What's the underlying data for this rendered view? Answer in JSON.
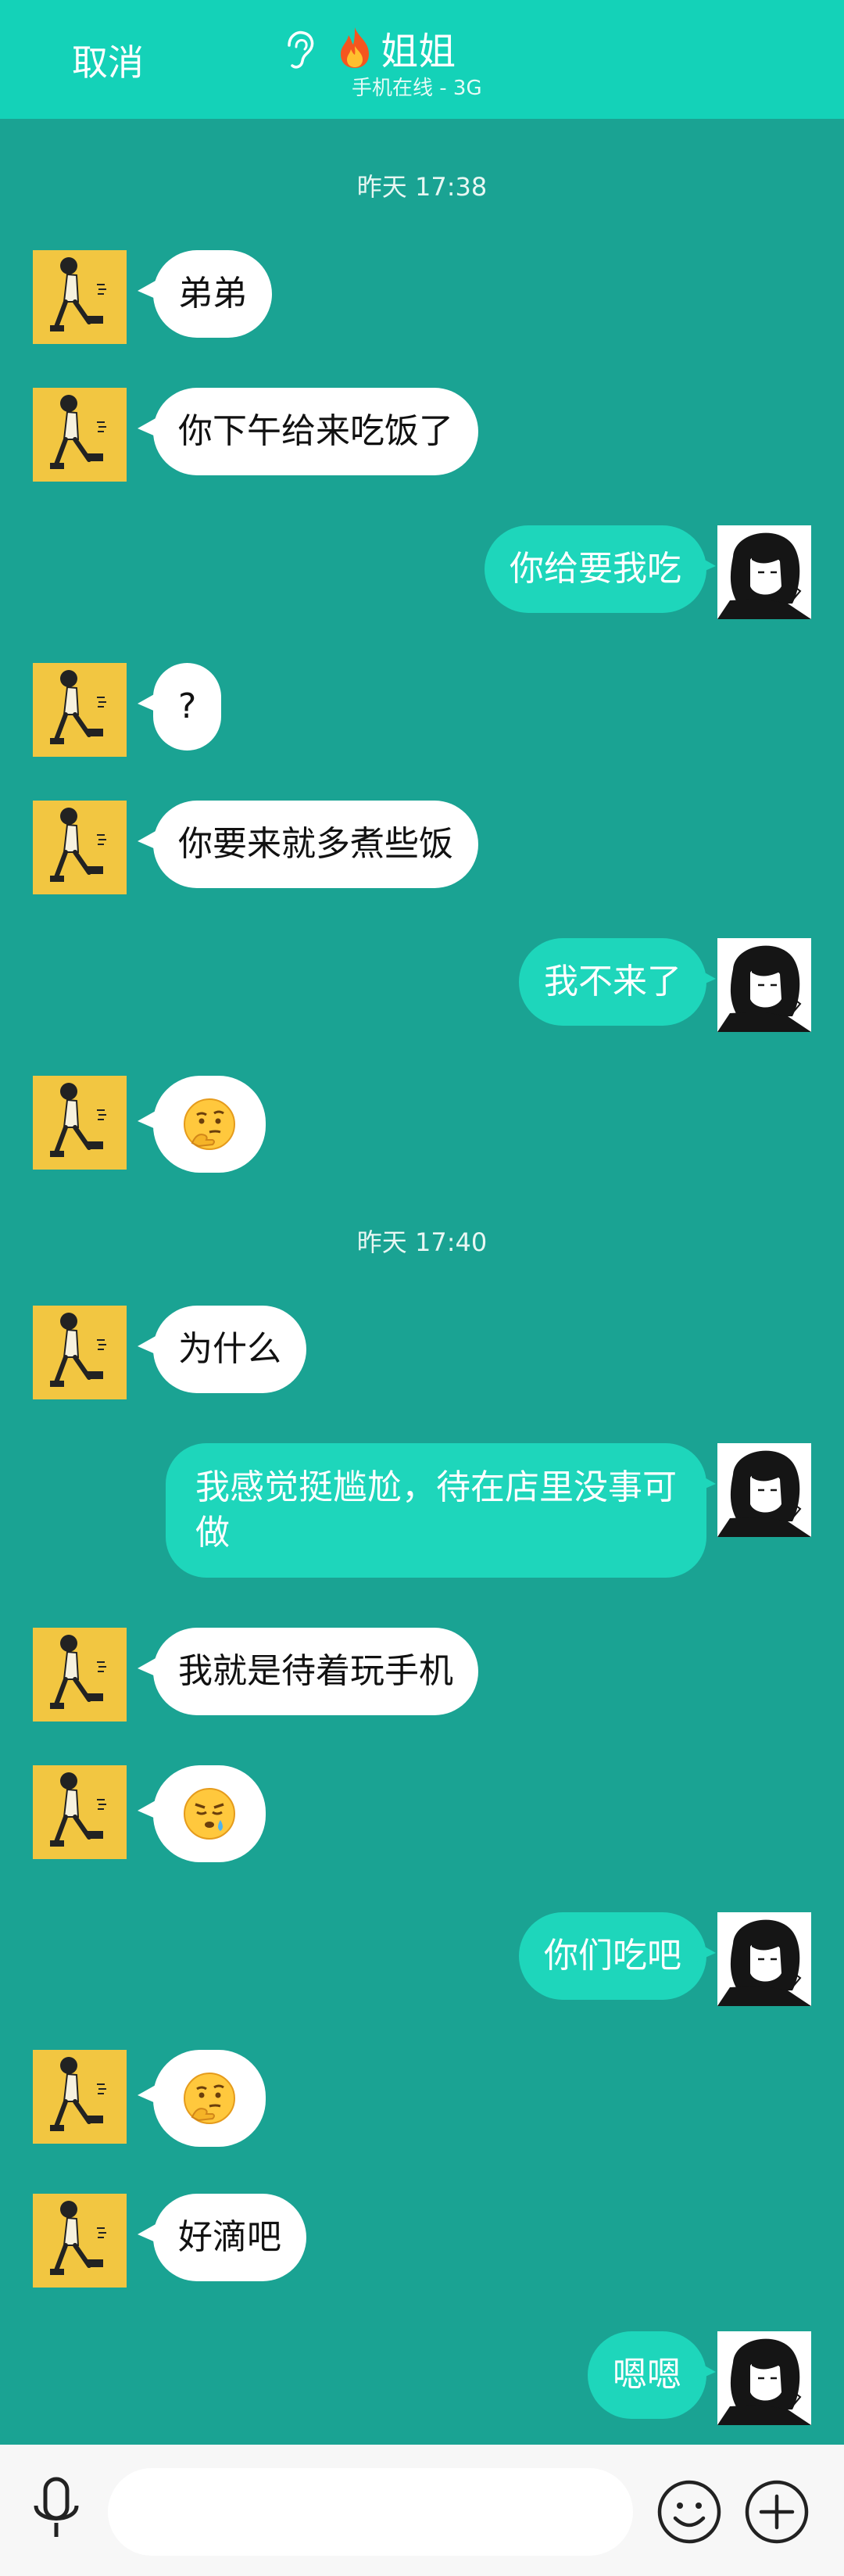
{
  "header": {
    "cancel_label": "取消",
    "title": "姐姐",
    "subtitle": "手机在线 - 3G",
    "accent_color": "#14d2b8"
  },
  "messages": [
    {
      "type": "time",
      "text": "昨天 17:38"
    },
    {
      "type": "msg",
      "side": "left",
      "text": "弟弟"
    },
    {
      "type": "msg",
      "side": "left",
      "text": "你下午给来吃饭了"
    },
    {
      "type": "msg",
      "side": "right",
      "text": "你给要我吃"
    },
    {
      "type": "msg",
      "side": "left",
      "text": "?"
    },
    {
      "type": "msg",
      "side": "left",
      "text": "你要来就多煮些饭"
    },
    {
      "type": "msg",
      "side": "right",
      "text": "我不来了"
    },
    {
      "type": "msg",
      "side": "left",
      "emoji": "thinking-face-emoji"
    },
    {
      "type": "time",
      "text": "昨天 17:40"
    },
    {
      "type": "msg",
      "side": "left",
      "text": "为什么"
    },
    {
      "type": "msg",
      "side": "right",
      "text": "我感觉挺尴尬，待在店里没事可做"
    },
    {
      "type": "msg",
      "side": "left",
      "text": "我就是待着玩手机"
    },
    {
      "type": "msg",
      "side": "left",
      "emoji": "pouting-face-emoji"
    },
    {
      "type": "msg",
      "side": "right",
      "text": "你们吃吧"
    },
    {
      "type": "msg",
      "side": "left",
      "emoji": "thinking-face-emoji"
    },
    {
      "type": "msg",
      "side": "left",
      "text": "好滴吧"
    },
    {
      "type": "msg",
      "side": "right",
      "text": "嗯嗯"
    }
  ],
  "bottom_bar": {
    "voice_icon": "microphone-icon",
    "input_value": "",
    "emoji_icon": "smiley-icon",
    "more_icon": "plus-circle-icon"
  }
}
